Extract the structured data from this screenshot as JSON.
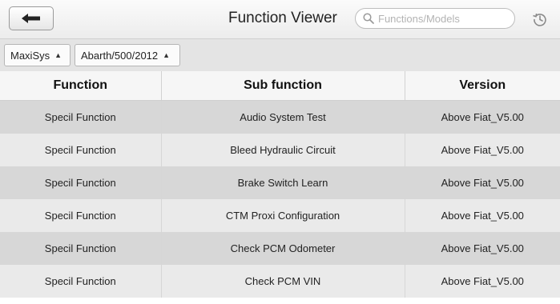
{
  "header": {
    "title": "Function Viewer",
    "search_placeholder": "Functions/Models"
  },
  "icons": {
    "back": "back-arrow-icon",
    "search": "search-icon",
    "history": "history-icon"
  },
  "filters": [
    {
      "label": "MaxiSys"
    },
    {
      "label": "Abarth/500/2012"
    }
  ],
  "table": {
    "columns": [
      "Function",
      "Sub function",
      "Version"
    ],
    "rows": [
      {
        "function": "Specil Function",
        "sub_function": "Audio System Test",
        "version": "Above Fiat_V5.00"
      },
      {
        "function": "Specil Function",
        "sub_function": "Bleed Hydraulic Circuit",
        "version": "Above Fiat_V5.00"
      },
      {
        "function": "Specil Function",
        "sub_function": "Brake Switch Learn",
        "version": "Above Fiat_V5.00"
      },
      {
        "function": "Specil Function",
        "sub_function": "CTM Proxi Configuration",
        "version": "Above Fiat_V5.00"
      },
      {
        "function": "Specil Function",
        "sub_function": "Check PCM Odometer",
        "version": "Above Fiat_V5.00"
      },
      {
        "function": "Specil Function",
        "sub_function": "Check PCM VIN",
        "version": "Above Fiat_V5.00"
      }
    ]
  }
}
